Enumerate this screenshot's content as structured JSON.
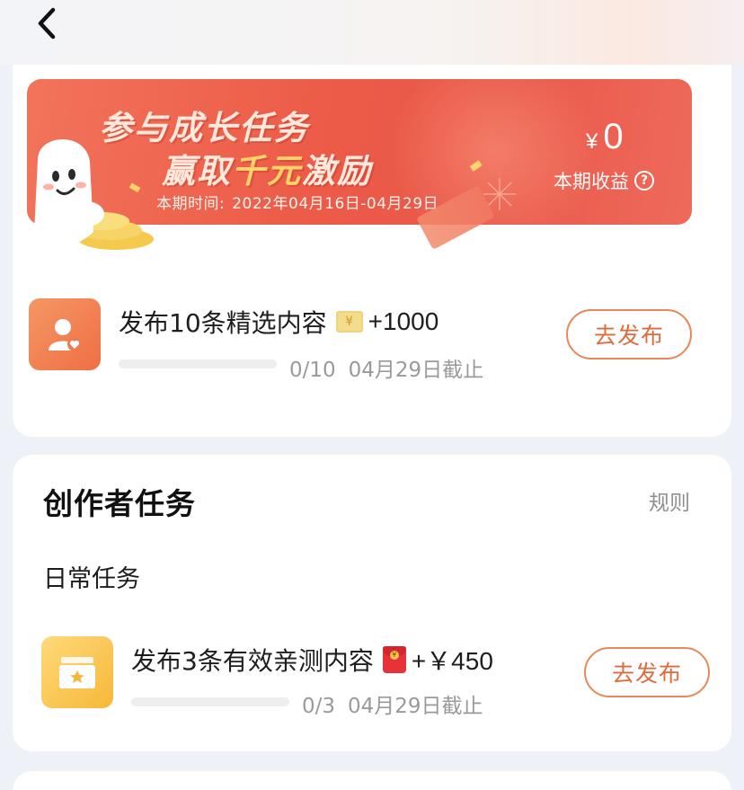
{
  "nav": {
    "back_icon": "chevron-left-icon"
  },
  "banner": {
    "headline_line1": "参与成长任务",
    "headline_line2_prefix": "赢取",
    "headline_line2_highlight": "千元",
    "headline_line2_suffix": "激励",
    "period_label": "本期时间:",
    "period_value": "2022年04月16日-04月29日",
    "earnings_currency": "¥",
    "earnings_value": "0",
    "earnings_label": "本期收益",
    "help_icon": "question-circle-icon",
    "colors": {
      "start": "#f2735b",
      "end": "#e9584a",
      "highlight": "#ffd36b"
    }
  },
  "growth_task": {
    "icon": "user-heart-icon",
    "title": "发布10条精选内容",
    "reward_icon": "coin-icon",
    "reward": "+1000",
    "progress_text": "0/10",
    "progress_fraction": 0,
    "deadline": "04月29日截止",
    "button_label": "去发布"
  },
  "creator_tasks": {
    "section_title": "创作者任务",
    "rules_link": "规则",
    "daily_heading": "日常任务",
    "tasks": [
      {
        "icon": "star-box-icon",
        "title": "发布3条有效亲测内容",
        "reward_icon": "red-packet-icon",
        "reward": "+￥450",
        "progress_text": "0/3",
        "progress_fraction": 0,
        "deadline": "04月29日截止",
        "button_label": "去发布"
      }
    ]
  },
  "colors": {
    "accent": "#df6a3c",
    "page_bg": "#eef1f7",
    "card_bg": "#ffffff",
    "muted_text": "#9a9a9a"
  }
}
